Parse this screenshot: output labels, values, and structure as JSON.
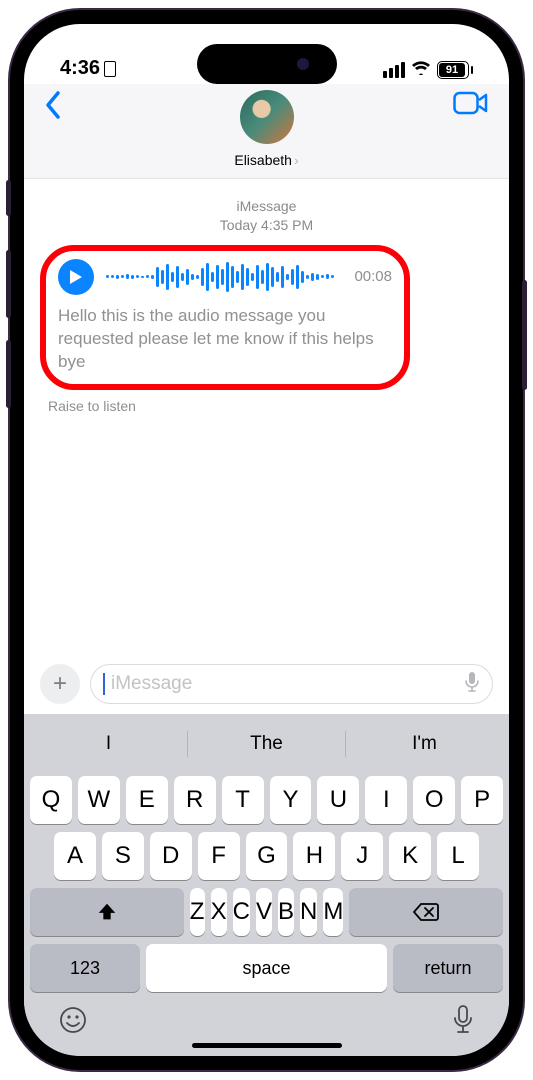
{
  "status": {
    "time": "4:36",
    "battery": "91"
  },
  "header": {
    "contact_name": "Elisabeth"
  },
  "thread": {
    "service": "iMessage",
    "timestamp": "Today 4:35 PM",
    "audio": {
      "duration": "00:08",
      "transcription": "Hello this is the audio message you requested please let me know if this helps bye"
    },
    "hint": "Raise to listen"
  },
  "compose": {
    "placeholder": "iMessage"
  },
  "keyboard": {
    "suggestions": [
      "I",
      "The",
      "I'm"
    ],
    "row1": [
      "Q",
      "W",
      "E",
      "R",
      "T",
      "Y",
      "U",
      "I",
      "O",
      "P"
    ],
    "row2": [
      "A",
      "S",
      "D",
      "F",
      "G",
      "H",
      "J",
      "K",
      "L"
    ],
    "row3": [
      "Z",
      "X",
      "C",
      "V",
      "B",
      "N",
      "M"
    ],
    "numKey": "123",
    "spaceKey": "space",
    "returnKey": "return"
  }
}
